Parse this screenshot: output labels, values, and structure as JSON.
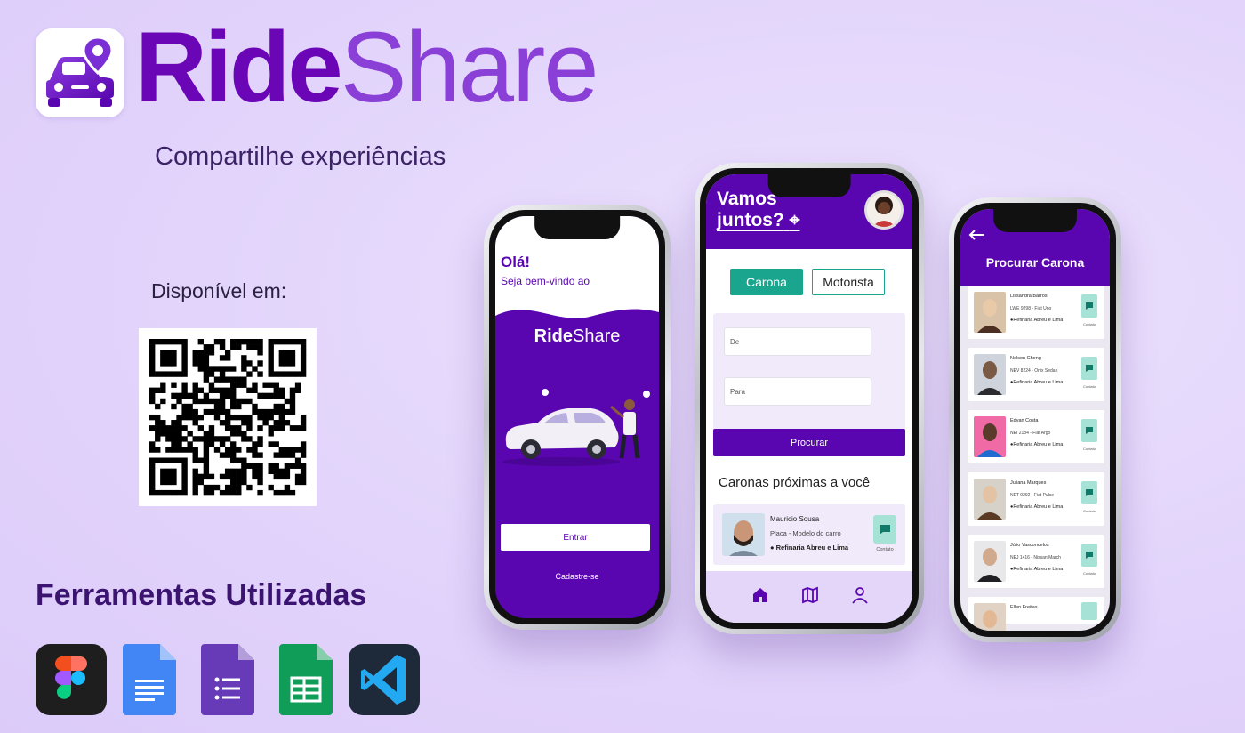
{
  "brand": {
    "name_bold": "Ride",
    "name_light": "Share",
    "tagline": "Compartilhe experiências"
  },
  "availability": {
    "label": "Disponível em:"
  },
  "tools": {
    "title": "Ferramentas Utilizadas",
    "items": [
      "figma-icon",
      "google-docs-icon",
      "google-forms-icon",
      "google-sheets-icon",
      "vscode-icon"
    ]
  },
  "phone_welcome": {
    "greeting": "Olá!",
    "subtitle": "Seja bem-vindo ao",
    "brand_bold": "Ride",
    "brand_light": "Share",
    "login_button": "Entrar",
    "signup_link": "Cadastre-se"
  },
  "phone_home": {
    "title_line1": "Vamos",
    "title_line2": "juntos?",
    "tabs": [
      "Carona",
      "Motorista"
    ],
    "from_placeholder": "De",
    "to_placeholder": "Para",
    "search_button": "Procurar",
    "nearby_title": "Caronas próximas a você",
    "nearby_card": {
      "name": "Mauricio Sousa",
      "car": "Placa - Modelo do carro",
      "location": "Refinaria Abreu e Lima",
      "contact": "Contato"
    }
  },
  "phone_search": {
    "title": "Procurar Carona",
    "contact_label": "Contato",
    "drivers": [
      {
        "name": "Lissandra Barros",
        "car": "LWE 9298 - Fiat Uno",
        "location": "Refinaria Abreu e Lima"
      },
      {
        "name": "Nelson Cheng",
        "car": "NEV 8224 - Onix Sedan",
        "location": "Refinaria Abreu e Lima"
      },
      {
        "name": "Edvan Costa",
        "car": "NEI 2184 - Fiat Argo",
        "location": "Refinaria Abreu e Lima"
      },
      {
        "name": "Juliana Marques",
        "car": "NET 9292 - Fiat Pulse",
        "location": "Refinaria Abreu e Lima"
      },
      {
        "name": "Júlio Vasconcelos",
        "car": "NEJ 1416 - Nissan March",
        "location": "Refinaria Abreu e Lima"
      },
      {
        "name": "Ellen Freitas",
        "car": "",
        "location": ""
      }
    ]
  },
  "colors": {
    "brand_purple": "#5a06b0",
    "accent_teal": "#1aa58e",
    "background": "#e4d7fb"
  }
}
